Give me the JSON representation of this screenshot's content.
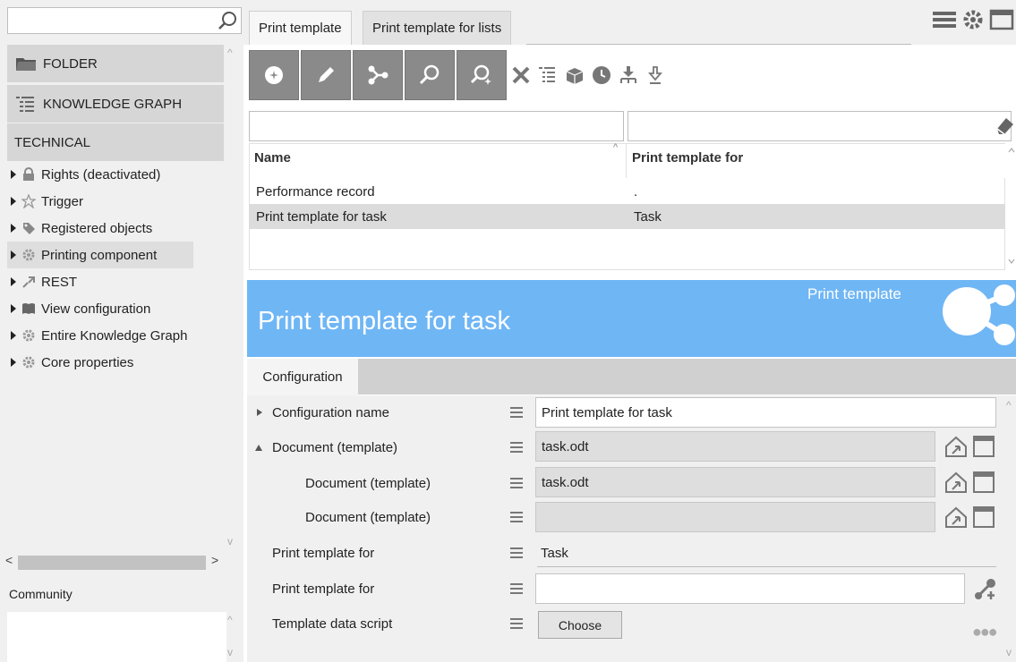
{
  "left": {
    "search": {
      "value": "",
      "placeholder": ""
    },
    "sections": [
      {
        "label": "FOLDER",
        "icon": "folder-icon"
      },
      {
        "label": "KNOWLEDGE GRAPH",
        "icon": "tree-list-icon"
      },
      {
        "label": "TECHNICAL"
      }
    ],
    "tree": [
      {
        "label": "Rights (deactivated)",
        "icon": "lock-icon"
      },
      {
        "label": "Trigger",
        "icon": "star-icon"
      },
      {
        "label": "Registered objects",
        "icon": "tag-icon"
      },
      {
        "label": "Printing component",
        "icon": "gear-icon",
        "selected": true
      },
      {
        "label": "REST",
        "icon": "rest-icon"
      },
      {
        "label": "View configuration",
        "icon": "book-icon"
      },
      {
        "label": "Entire Knowledge Graph",
        "icon": "gear-icon"
      },
      {
        "label": "Core properties",
        "icon": "gear-icon"
      }
    ],
    "community_label": "Community",
    "hscroll_left": "<",
    "hscroll_right": ">"
  },
  "tabs": [
    {
      "label": "Print template",
      "active": true
    },
    {
      "label": "Print template for lists",
      "active": false
    }
  ],
  "grid": {
    "headers": [
      "Name",
      "Print template for"
    ],
    "rows": [
      {
        "name": "Performance record",
        "for": "."
      },
      {
        "name": "Print template for task",
        "for": "Task",
        "selected": true
      }
    ]
  },
  "banner": {
    "title": "Print template for task",
    "type": "Print template",
    "color": "#6fb6f5"
  },
  "config": {
    "tab_label": "Configuration",
    "fields": [
      {
        "label": "Configuration name",
        "value": "Print template for task"
      },
      {
        "label": "Document (template)",
        "value": "task.odt"
      },
      {
        "label": "Document (template)",
        "value": "task.odt"
      },
      {
        "label": "Document (template)",
        "value": ""
      },
      {
        "label": "Print template for",
        "value": "Task"
      },
      {
        "label": "Print template for",
        "value": ""
      },
      {
        "label": "Template data script",
        "button": "Choose"
      }
    ]
  }
}
